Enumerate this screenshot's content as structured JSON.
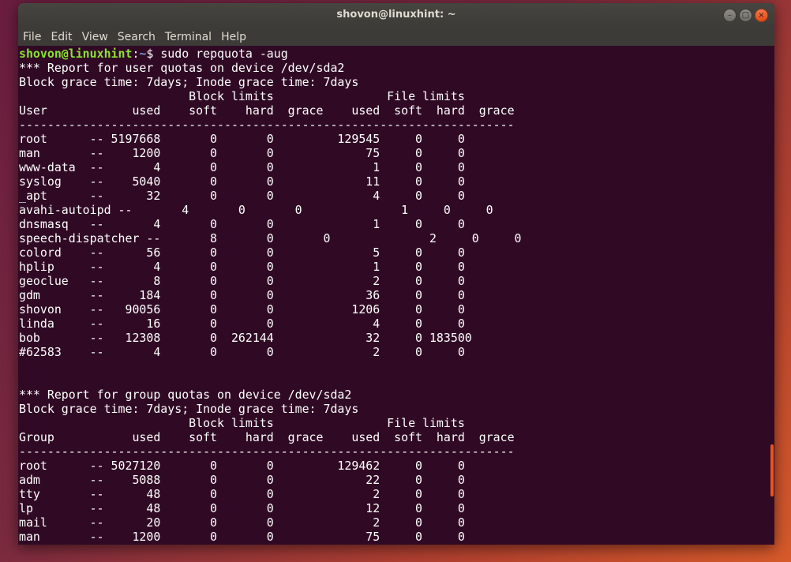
{
  "window": {
    "title": "shovon@linuxhint: ~",
    "controls": {
      "minimize_glyph": "–",
      "maximize_glyph": "□",
      "close_glyph": "×"
    }
  },
  "menubar": {
    "items": [
      "File",
      "Edit",
      "View",
      "Search",
      "Terminal",
      "Help"
    ]
  },
  "prompt": {
    "user_host": "shovon@linuxhint",
    "separator": ":",
    "path": "~",
    "symbol": "$ ",
    "command": "sudo repquota -aug"
  },
  "output_lines": [
    "*** Report for user quotas on device /dev/sda2",
    "Block grace time: 7days; Inode grace time: 7days",
    "                        Block limits                File limits",
    "User            used    soft    hard  grace    used  soft  hard  grace",
    "----------------------------------------------------------------------",
    "root      -- 5197668       0       0         129545     0     0",
    "man       --    1200       0       0             75     0     0",
    "www-data  --       4       0       0              1     0     0",
    "syslog    --    5040       0       0             11     0     0",
    "_apt      --      32       0       0              4     0     0",
    "avahi-autoipd --       4       0       0              1     0     0",
    "dnsmasq   --       4       0       0              1     0     0",
    "speech-dispatcher --       8       0       0              2     0     0",
    "colord    --      56       0       0              5     0     0",
    "hplip     --       4       0       0              1     0     0",
    "geoclue   --       8       0       0              2     0     0",
    "gdm       --     184       0       0             36     0     0",
    "shovon    --   90056       0       0           1206     0     0",
    "linda     --      16       0       0              4     0     0",
    "bob       --   12308       0  262144             32     0 183500",
    "#62583    --       4       0       0              2     0     0",
    "",
    "",
    "*** Report for group quotas on device /dev/sda2",
    "Block grace time: 7days; Inode grace time: 7days",
    "                        Block limits                File limits",
    "Group           used    soft    hard  grace    used  soft  hard  grace",
    "----------------------------------------------------------------------",
    "root      -- 5027120       0       0         129462     0     0",
    "adm       --    5088       0       0             22     0     0",
    "tty       --      48       0       0              2     0     0",
    "lp        --      48       0       0             12     0     0",
    "mail      --      20       0       0              2     0     0",
    "man       --    1200       0       0             75     0     0"
  ],
  "colors": {
    "terminal_bg": "#300a24",
    "prompt_user": "#8ae234",
    "prompt_path": "#729fcf",
    "scrollbar": "#e95420",
    "titlebar": "#3c3b37"
  }
}
